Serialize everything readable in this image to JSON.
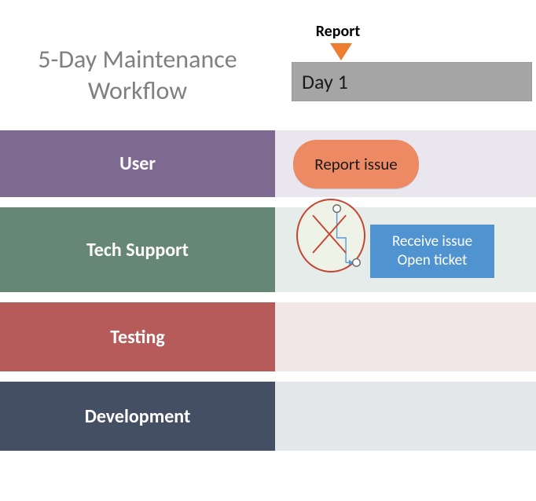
{
  "title_line1": "5-Day Maintenance",
  "title_line2": "Workflow",
  "report_label": "Report",
  "day_label": "Day 1",
  "lanes": {
    "user": "User",
    "tech": "Tech Support",
    "test": "Testing",
    "dev": "Development"
  },
  "tasks": {
    "report_issue": "Report issue",
    "receive_line1": "Receive issue",
    "receive_line2": "Open ticket"
  },
  "chart_data": {
    "type": "table",
    "title": "5-Day Maintenance Workflow",
    "columns": [
      "Day 1"
    ],
    "lanes": [
      "User",
      "Tech Support",
      "Testing",
      "Development"
    ],
    "tasks": [
      {
        "lane": "User",
        "day": "Day 1",
        "label": "Report issue",
        "shape": "rounded"
      },
      {
        "lane": "Tech Support",
        "day": "Day 1",
        "label": "Receive issue / Open ticket",
        "shape": "rect"
      }
    ],
    "markers": [
      {
        "label": "Report",
        "day": "Day 1"
      }
    ],
    "connectors": [
      {
        "from": "Report issue",
        "to": "Receive issue / Open ticket",
        "type": "elbow",
        "state": "placeholder-selected"
      }
    ]
  }
}
